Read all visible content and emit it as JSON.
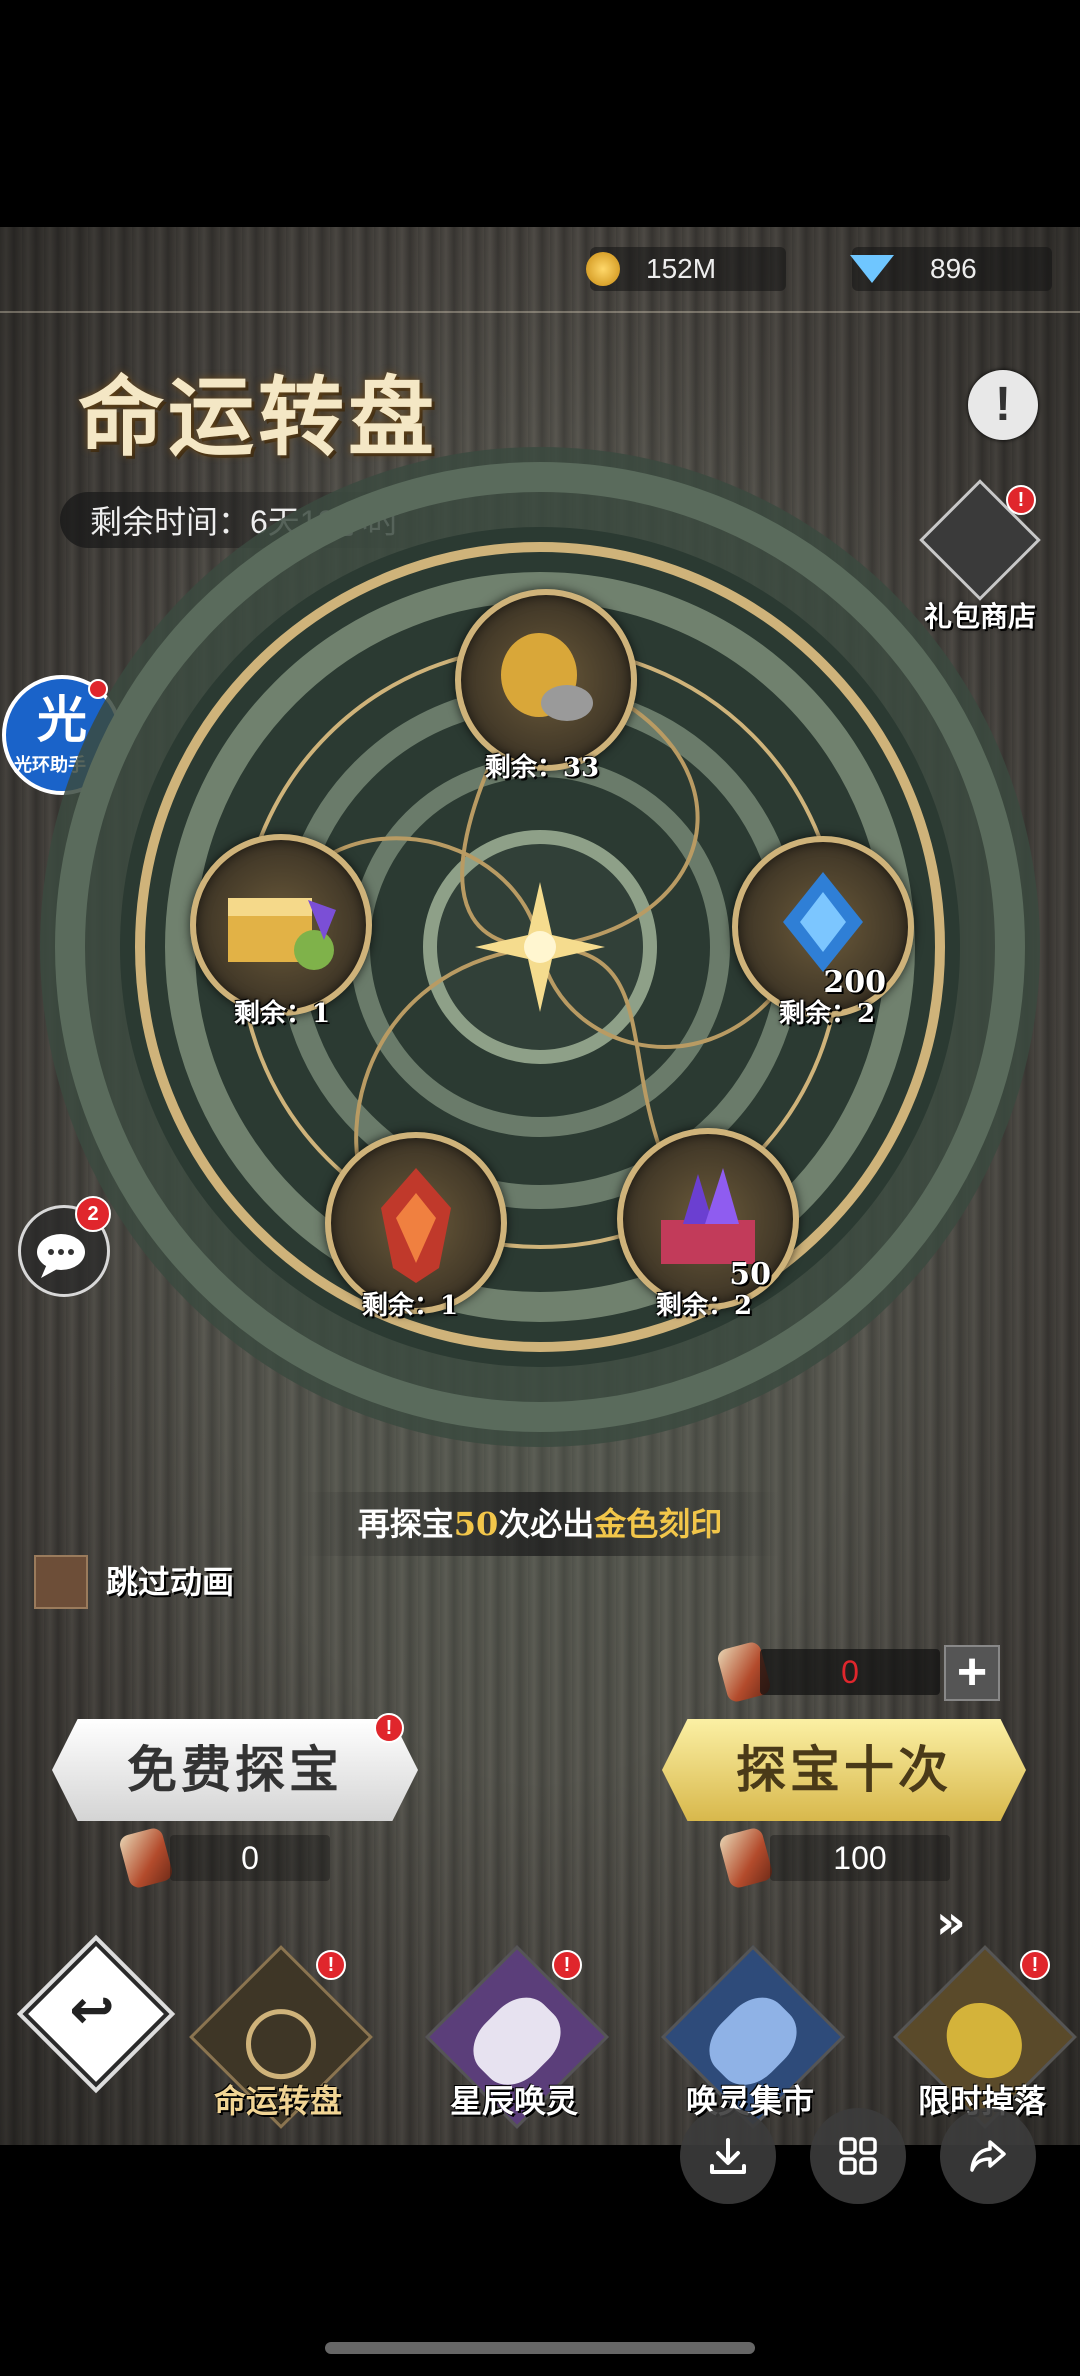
{
  "currency": {
    "gold": "152M",
    "diamond": "896"
  },
  "title": "命运转盘",
  "timer": "剩余时间：6天18小时",
  "gift_shop": {
    "label": "礼包商店"
  },
  "assistant": {
    "label": "光环助手",
    "glyph": "光"
  },
  "chat": {
    "badge": "2"
  },
  "wheel": {
    "nodes": [
      {
        "name": "sack-and-stones",
        "remain": "剩余：33",
        "qty": ""
      },
      {
        "name": "blue-crystal",
        "remain": "剩余：2",
        "qty": "200"
      },
      {
        "name": "purple-crystal-chest",
        "remain": "剩余：2",
        "qty": "50"
      },
      {
        "name": "red-dragon-emblem",
        "remain": "剩余：1",
        "qty": ""
      },
      {
        "name": "golden-treasure-chest",
        "remain": "剩余：1",
        "qty": ""
      }
    ]
  },
  "banner": {
    "prefix": "再探宝",
    "count": "50",
    "middle": "次必出",
    "reward": "金色刻印"
  },
  "skip_animation": "跳过动画",
  "ticket_count_top": "0",
  "ticket_cost_free": "0",
  "ticket_cost_ten": "100",
  "buttons": {
    "free": "免费探宝",
    "ten": "探宝十次",
    "plus": "+"
  },
  "tabs": [
    {
      "label": "命运转盘",
      "active": true
    },
    {
      "label": "星辰唤灵",
      "active": false
    },
    {
      "label": "唤灵集市",
      "active": false
    },
    {
      "label": "限时掉落",
      "active": false
    }
  ],
  "colors": {
    "gold_text": "#f2c64a",
    "red_count": "#e0262c",
    "wheel_ring": "#cfb37a"
  }
}
